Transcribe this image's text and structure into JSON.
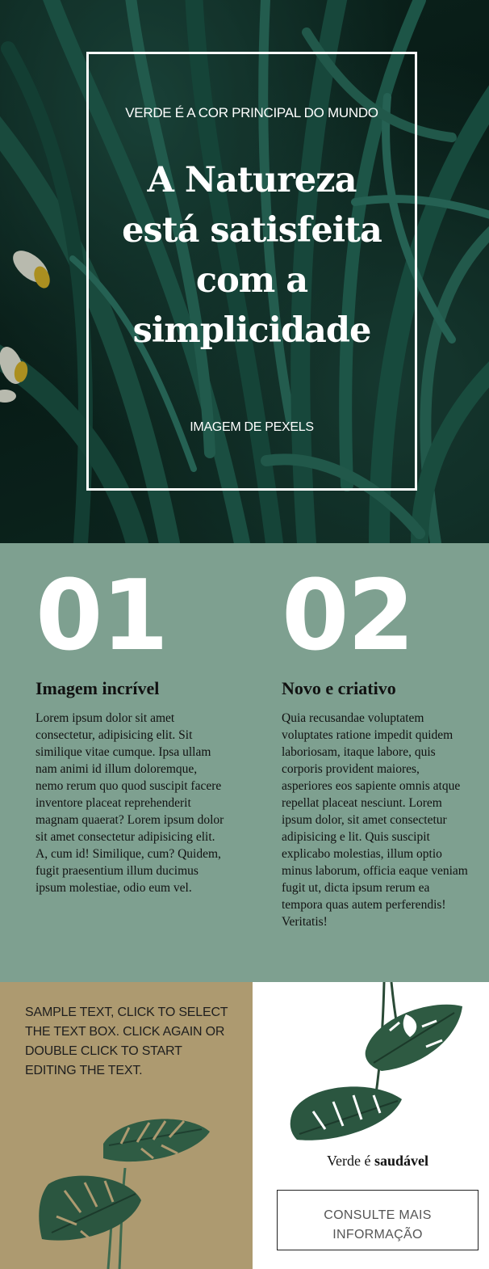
{
  "colors": {
    "hero_dark": "#0b221d",
    "features_bg": "#7ea090",
    "promo_bg": "#ad9a70",
    "leaf_green": "#2f5c44",
    "text_dark": "#111111"
  },
  "hero": {
    "kicker": "VERDE É A COR PRINCIPAL DO MUNDO",
    "title": "A Natureza está satisfeita com a simplicidade",
    "credit": "IMAGEM DE PEXELS"
  },
  "features": [
    {
      "number": "01",
      "title_bold": "Imagem",
      "title_regular": " incrível",
      "body": "Lorem ipsum dolor sit amet consectetur, adipisicing elit. Sit similique vitae cumque. Ipsa ullam nam animi id illum doloremque, nemo rerum quo quod suscipit facere inventore placeat reprehenderit magnam quaerat? Lorem ipsum dolor sit amet consectetur adipisicing elit. A, cum id! Similique, cum? Quidem, fugit praesentium illum ducimus ipsum molestiae, odio eum vel."
    },
    {
      "number": "02",
      "title_regular": "Novo e ",
      "title_bold": "criativo",
      "body": "Quia recusandae voluptatem voluptates ratione impedit quidem laboriosam, itaque labore, quis corporis provident maiores, asperiores eos sapiente omnis atque repellat placeat nesciunt. Lorem ipsum dolor, sit amet consectetur adipisicing e lit. Quis suscipit explicabo molestias, illum optio minus laborum, officia eaque veniam fugit ut, dicta ipsum rerum ea tempora quas autem perferendis! Veritatis!"
    }
  ],
  "promo": {
    "text": "SAMPLE TEXT, CLICK TO SELECT THE TEXT BOX. CLICK AGAIN OR DOUBLE CLICK TO START EDITING THE TEXT."
  },
  "cta": {
    "caption_regular": "Verde é ",
    "caption_bold": "saudável",
    "button_label": "CONSULTE MAIS INFORMAÇÃO"
  },
  "icons": {
    "hero_image": "tropical-leaves-photo",
    "promo_image": "monstera-plant-photo",
    "cta_image": "hanging-monstera-photo"
  }
}
